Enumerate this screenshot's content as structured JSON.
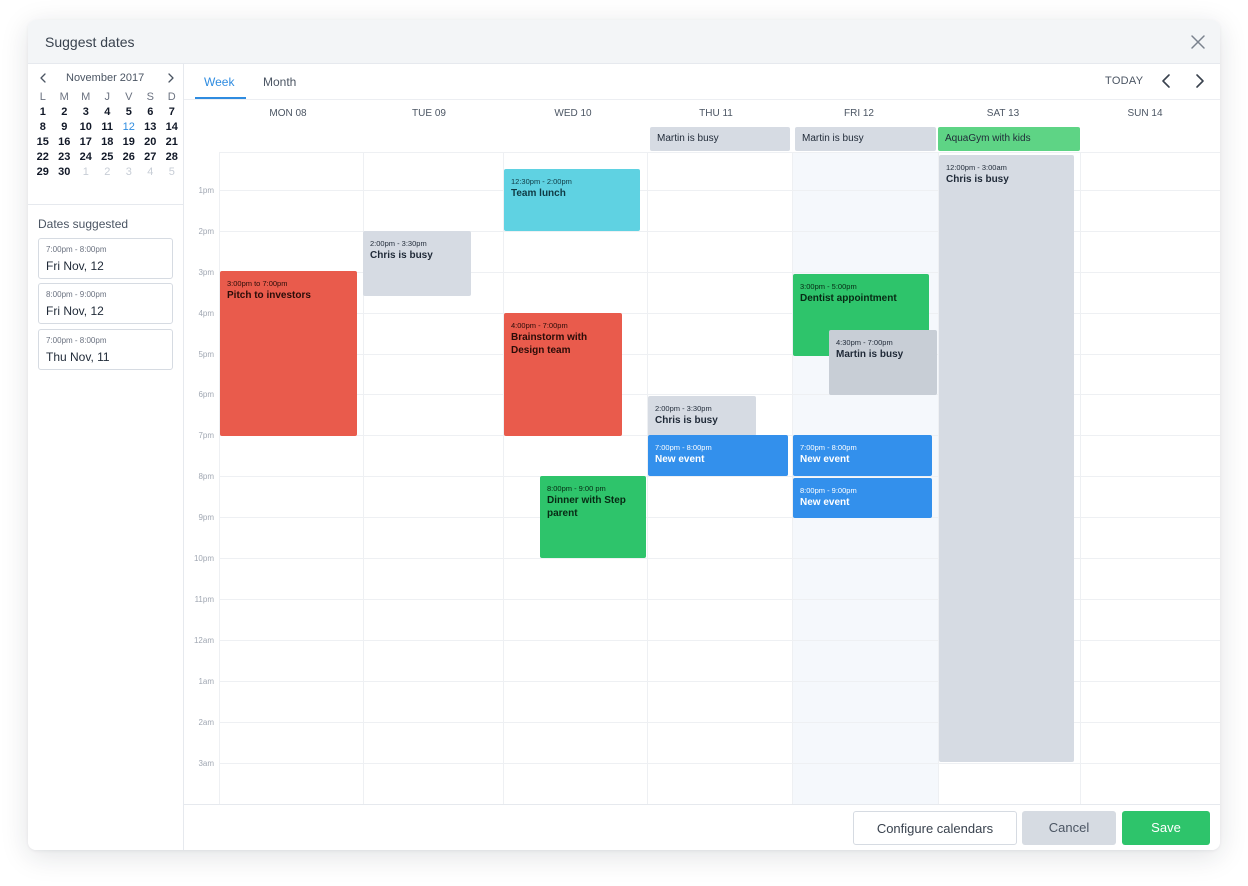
{
  "modal": {
    "title": "Suggest dates"
  },
  "sidebar": {
    "month_label": "November 2017",
    "weekdays": [
      "L",
      "M",
      "M",
      "J",
      "V",
      "S",
      "D"
    ],
    "weeks": [
      [
        "1",
        "2",
        "3",
        "4",
        "5",
        "6",
        "7"
      ],
      [
        "8",
        "9",
        "10",
        "11",
        "12",
        "13",
        "14"
      ],
      [
        "15",
        "16",
        "17",
        "18",
        "19",
        "20",
        "21"
      ],
      [
        "22",
        "23",
        "24",
        "25",
        "26",
        "27",
        "28"
      ],
      [
        "29",
        "30",
        "1",
        "2",
        "3",
        "4",
        "5"
      ]
    ],
    "dates_title": "Dates suggested",
    "suggestions": [
      {
        "time": "7:00pm - 8:00pm",
        "date": "Fri Nov, 12"
      },
      {
        "time": "8:00pm - 9:00pm",
        "date": "Fri Nov, 12"
      },
      {
        "time": "7:00pm - 8:00pm",
        "date": "Thu Nov, 11"
      }
    ]
  },
  "toolbar": {
    "tab_week": "Week",
    "tab_month": "Month",
    "today": "TODAY"
  },
  "days": [
    "MON 08",
    "TUE 09",
    "WED 10",
    "THU 11",
    "FRI 12",
    "SAT 13",
    "SUN 14"
  ],
  "hours": [
    "1pm",
    "2pm",
    "3pm",
    "4pm",
    "5pm",
    "6pm",
    "7pm",
    "8pm",
    "9pm",
    "10pm",
    "11pm",
    "12am",
    "1am",
    "2am",
    "3am"
  ],
  "allday_events": [
    {
      "title": "Martin is busy",
      "color": "#d6dbe3"
    },
    {
      "title": "Martin is busy",
      "color": "#d6dbe3"
    },
    {
      "title": "AquaGym with kids",
      "color": "#5ed485"
    }
  ],
  "events": [
    {
      "time": "12:30pm - 2:00pm",
      "name": "Team lunch",
      "color": "#5fd2e2"
    },
    {
      "time": "12:00pm - 3:00am",
      "name": "Chris is busy",
      "color": "#d6dbe3"
    },
    {
      "time": "2:00pm - 3:30pm",
      "name": "Chris is busy",
      "color": "#d6dbe3"
    },
    {
      "time": "3:00pm to 7:00pm",
      "name": "Pitch to investors",
      "color": "#e95b4c"
    },
    {
      "time": "3:00pm - 5:00pm",
      "name": "Dentist appointment",
      "color": "#2ec46b"
    },
    {
      "time": "4:00pm - 7:00pm",
      "name": "Brainstorm with Design team",
      "color": "#e95b4c"
    },
    {
      "time": "4:30pm - 7:00pm",
      "name": "Martin is busy",
      "color": "#c8ced6"
    },
    {
      "time": "2:00pm - 3:30pm",
      "name": "Chris is busy",
      "color": "#d6dbe3"
    },
    {
      "time": "7:00pm - 8:00pm",
      "name": "New event",
      "color": "#3390ec"
    },
    {
      "time": "7:00pm - 8:00pm",
      "name": "New event",
      "color": "#3390ec"
    },
    {
      "time": "8:00pm - 9:00pm",
      "name": "New event",
      "color": "#3390ec"
    },
    {
      "time": "8:00pm - 9:00 pm",
      "name": "Dinner with Step parent",
      "color": "#2ec46b"
    }
  ],
  "footer": {
    "configure": "Configure calendars",
    "cancel": "Cancel",
    "save": "Save"
  }
}
